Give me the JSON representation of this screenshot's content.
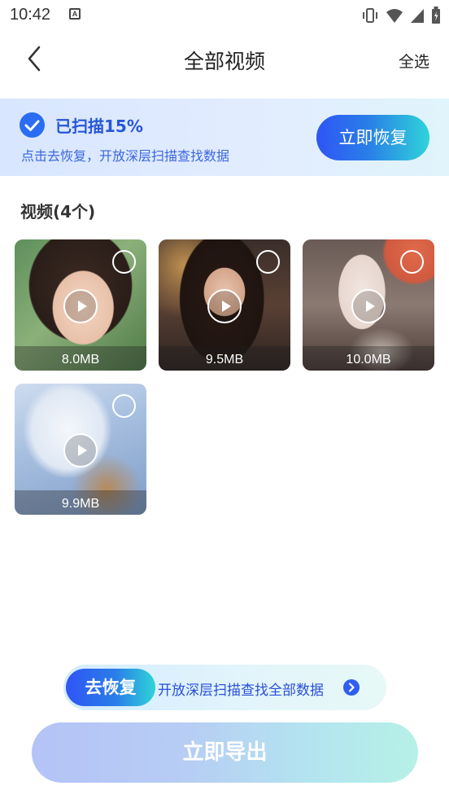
{
  "status_bar": {
    "time": "10:42",
    "notification_letter": "A",
    "icons": [
      "vibrate-icon",
      "wifi-icon",
      "signal-icon",
      "battery-icon"
    ]
  },
  "header": {
    "back_icon": "chevron-left-icon",
    "title": "全部视频",
    "select_all_label": "全选"
  },
  "scan_banner": {
    "title": "已扫描15%",
    "subtitle": "点击去恢复，开放深层扫描查找数据",
    "button_label": "立即恢复",
    "accent": "#2a6df4"
  },
  "section": {
    "title": "视频(4个)"
  },
  "videos": [
    {
      "size": "8.0MB",
      "thumbnail": "girl-portrait-outdoor"
    },
    {
      "size": "9.5MB",
      "thumbnail": "girl-singing-microphone"
    },
    {
      "size": "10.0MB",
      "thumbnail": "girl-sitting-street"
    },
    {
      "size": "9.9MB",
      "thumbnail": "white-dragon-art"
    }
  ],
  "promo": {
    "tag_label": "去恢复",
    "text": "开放深层扫描查找全部数据",
    "arrow_icon": "chevron-right-icon"
  },
  "export_button": {
    "label": "立即导出"
  }
}
